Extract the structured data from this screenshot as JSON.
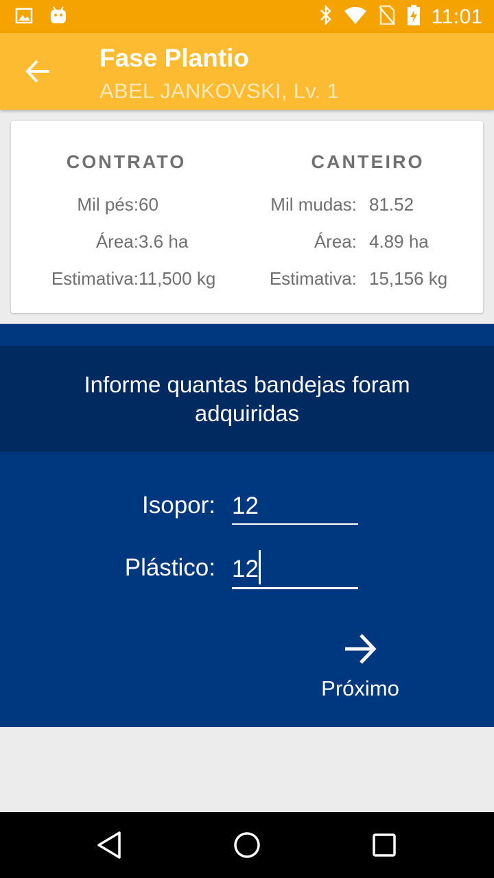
{
  "status_bar": {
    "time": "11:01",
    "icons": [
      "image-notification-icon",
      "android-notification-icon",
      "bluetooth-icon",
      "wifi-icon",
      "no-sim-icon",
      "battery-charging-icon"
    ]
  },
  "app_bar": {
    "title": "Fase Plantio",
    "subtitle": "ABEL JANKOVSKI, Lv. 1",
    "back_icon": "arrow-left-icon"
  },
  "info_card": {
    "contrato": {
      "header": "CONTRATO",
      "rows": [
        {
          "label": "Mil pés:",
          "value": "60"
        },
        {
          "label": "Área:",
          "value": "3.6 ha"
        },
        {
          "label": "Estimativa:",
          "value": "11,500 kg"
        }
      ]
    },
    "canteiro": {
      "header": "CANTEIRO",
      "rows": [
        {
          "label": "Mil mudas:",
          "value": "81.52"
        },
        {
          "label": "Área:",
          "value": "4.89 ha"
        },
        {
          "label": "Estimativa:",
          "value": "15,156 kg"
        }
      ]
    }
  },
  "form": {
    "prompt": "Informe quantas bandejas foram adquiridas",
    "fields": [
      {
        "label": "Isopor:",
        "value": "12"
      },
      {
        "label": "Plástico:",
        "value": "12"
      }
    ],
    "next_label": "Próximo",
    "next_icon": "arrow-right-icon"
  },
  "nav_bar": {
    "icons": [
      "nav-back-icon",
      "nav-home-icon",
      "nav-recent-icon"
    ]
  },
  "colors": {
    "status_bar": "#f4a300",
    "app_bar": "#fcbb30",
    "blue_section": "#00387f",
    "prompt_band": "#002a60",
    "background": "#ececec"
  }
}
